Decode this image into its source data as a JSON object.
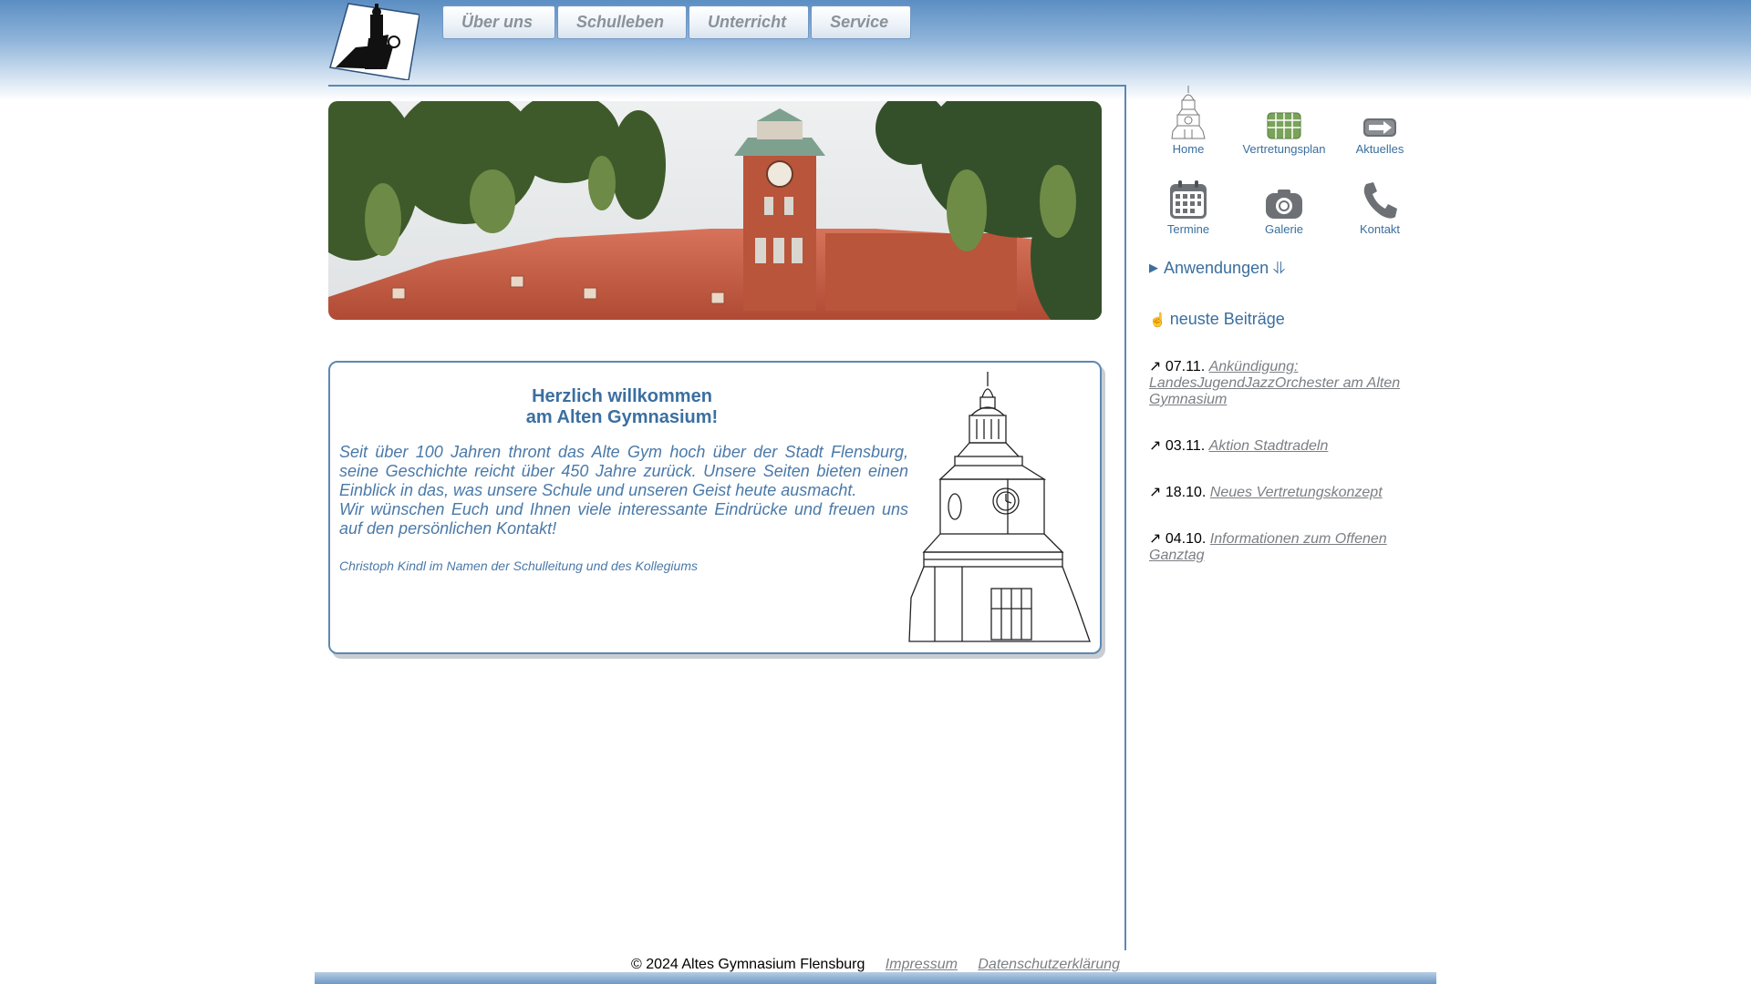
{
  "nav": {
    "items": [
      {
        "label": "Über uns"
      },
      {
        "label": "Schulleben"
      },
      {
        "label": "Unterricht"
      },
      {
        "label": "Service"
      }
    ]
  },
  "quick_links": [
    {
      "label": "Home",
      "icon": "tower-icon"
    },
    {
      "label": "Vertretungsplan",
      "icon": "substitution-plan-icon"
    },
    {
      "label": "Aktuelles",
      "icon": "arrow-sign-icon"
    },
    {
      "label": "Termine",
      "icon": "calendar-icon"
    },
    {
      "label": "Galerie",
      "icon": "camera-icon"
    },
    {
      "label": "Kontakt",
      "icon": "phone-icon"
    }
  ],
  "apps_toggle": "Anwendungen ⥥",
  "news": {
    "heading": "neuste Beiträge",
    "items": [
      {
        "date": "07.11.",
        "title": "Ankündigung: LandesJugendJazzOrchester am Alten Gymnasium"
      },
      {
        "date": "03.11.",
        "title": "Aktion Stadtradeln"
      },
      {
        "date": "18.10.",
        "title": "Neues Vertretungskonzept"
      },
      {
        "date": "04.10.",
        "title": "Informationen zum Offenen Ganztag"
      }
    ]
  },
  "welcome": {
    "title_line1": "Herzlich willkommen",
    "title_line2": "am Alten Gymnasium!",
    "paragraph1": "Seit über 100 Jahren thront das Alte Gym hoch über der Stadt Flensburg, seine Geschichte reicht über 450 Jahre zurück. Unsere Seiten bieten einen Einblick in das, was unsere Schule und unseren Geist heute ausmacht.",
    "paragraph2": "Wir wünschen Euch und Ihnen viele interessante Eindrücke und freuen uns auf den persönlichen Kontakt!",
    "signature": "Christoph Kindl im Namen der Schulleitung und des Kollegiums"
  },
  "footer": {
    "copyright": "© 2024 Altes Gymnasium Flensburg",
    "imprint": "Impressum",
    "privacy": "Datenschutzerklärung"
  },
  "colors": {
    "accent": "#3a6e9e",
    "link_gray": "#7b7f83",
    "brick": "#c0603e"
  }
}
